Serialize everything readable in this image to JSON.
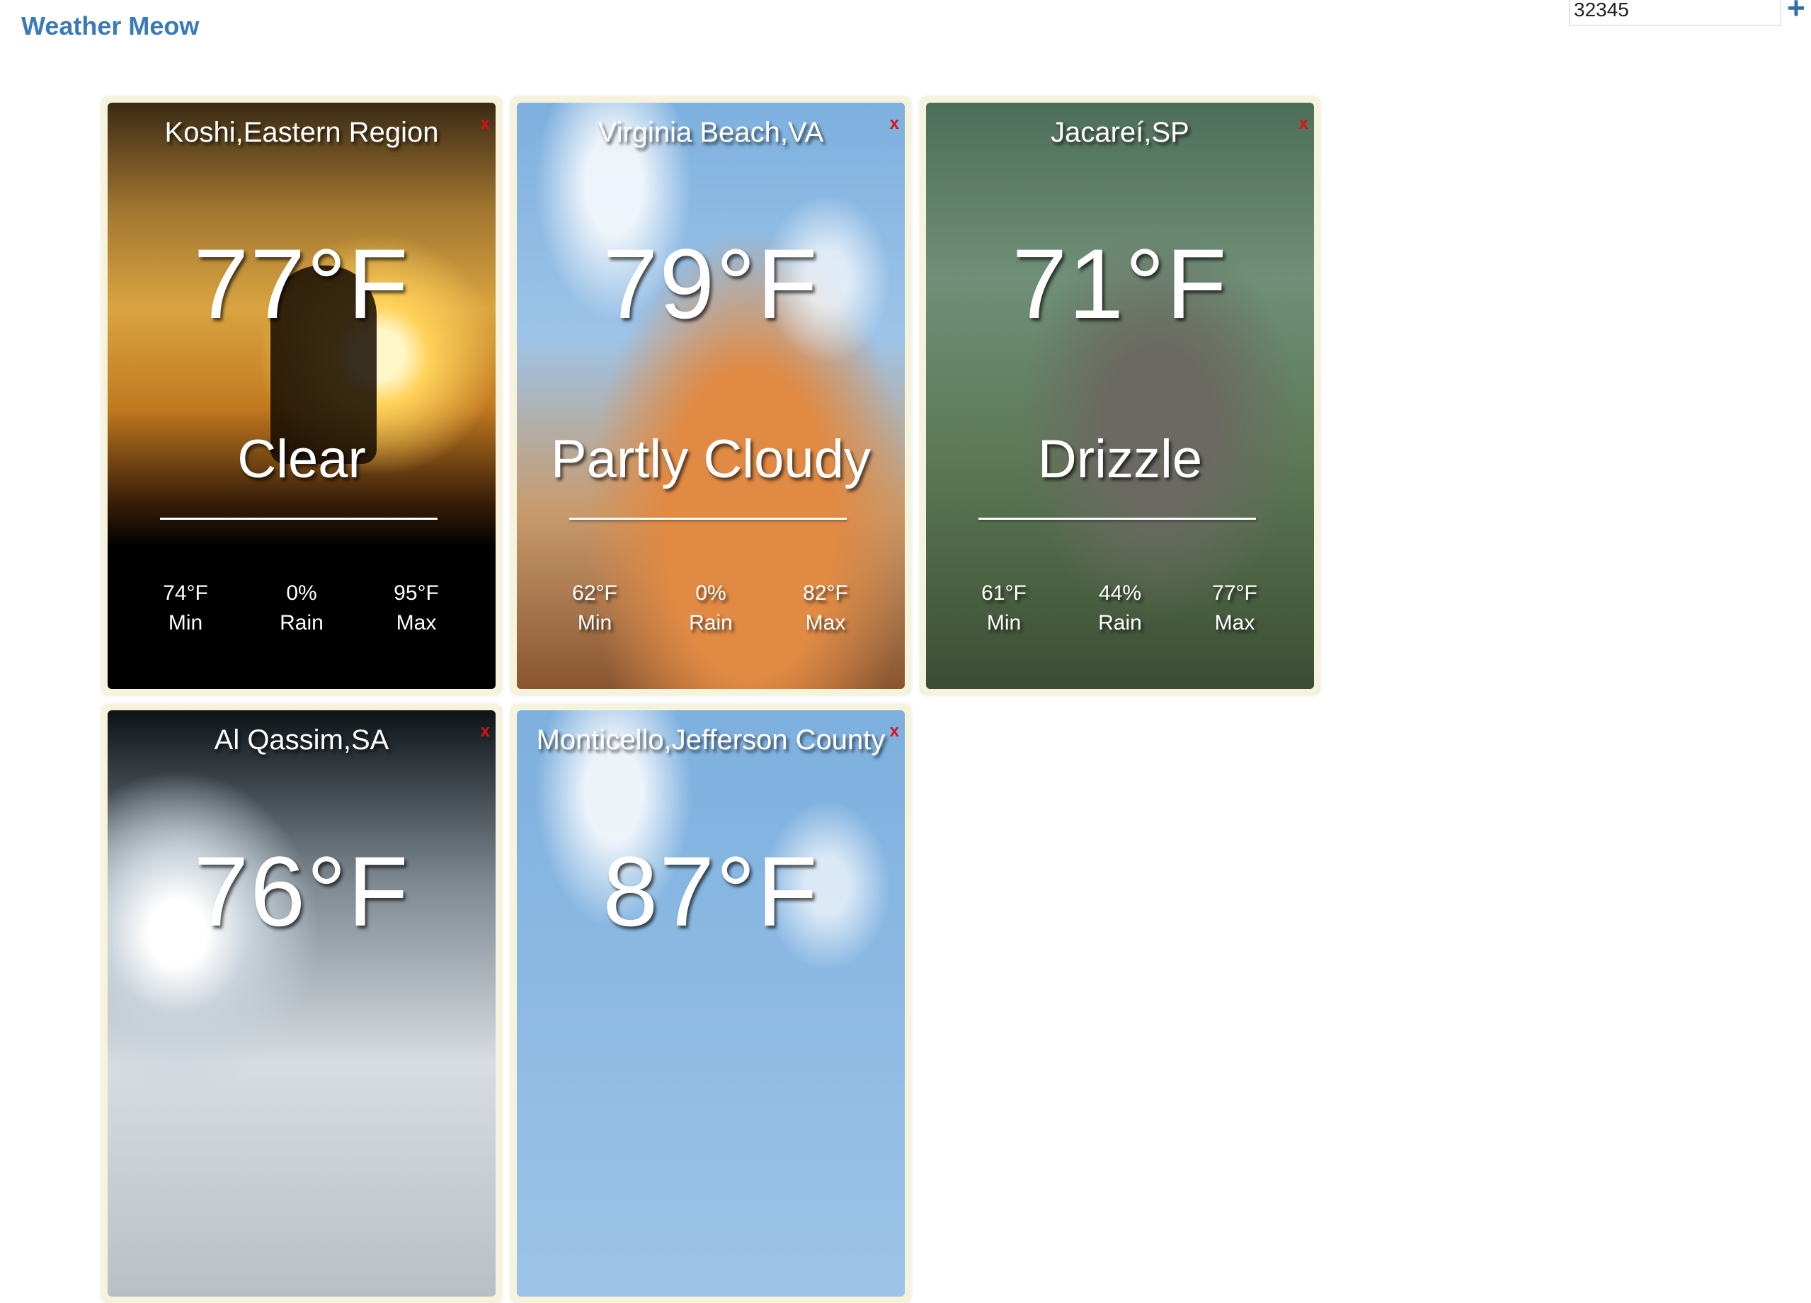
{
  "app": {
    "title": "Weather Meow"
  },
  "search": {
    "value": "32345",
    "add_icon": "plus-icon"
  },
  "close_label": "x",
  "labels": {
    "min": "Min",
    "rain": "Rain",
    "max": "Max"
  },
  "cards": [
    {
      "city": "Koshi,Eastern Region",
      "temp": "77°F",
      "condition": "Clear",
      "min": "74°F",
      "rain": "0%",
      "max": "95°F"
    },
    {
      "city": "Virginia Beach,VA",
      "temp": "79°F",
      "condition": "Partly Cloudy",
      "min": "62°F",
      "rain": "0%",
      "max": "82°F"
    },
    {
      "city": "Jacareí,SP",
      "temp": "71°F",
      "condition": "Drizzle",
      "min": "61°F",
      "rain": "44%",
      "max": "77°F"
    },
    {
      "city": "Al Qassim,SA",
      "temp": "76°F"
    },
    {
      "city": "Monticello,Jefferson County",
      "temp": "87°F"
    }
  ],
  "colors": {
    "brand": "#3a7ab8",
    "close": "#e01010",
    "card_frame": "#f6f3dc"
  }
}
